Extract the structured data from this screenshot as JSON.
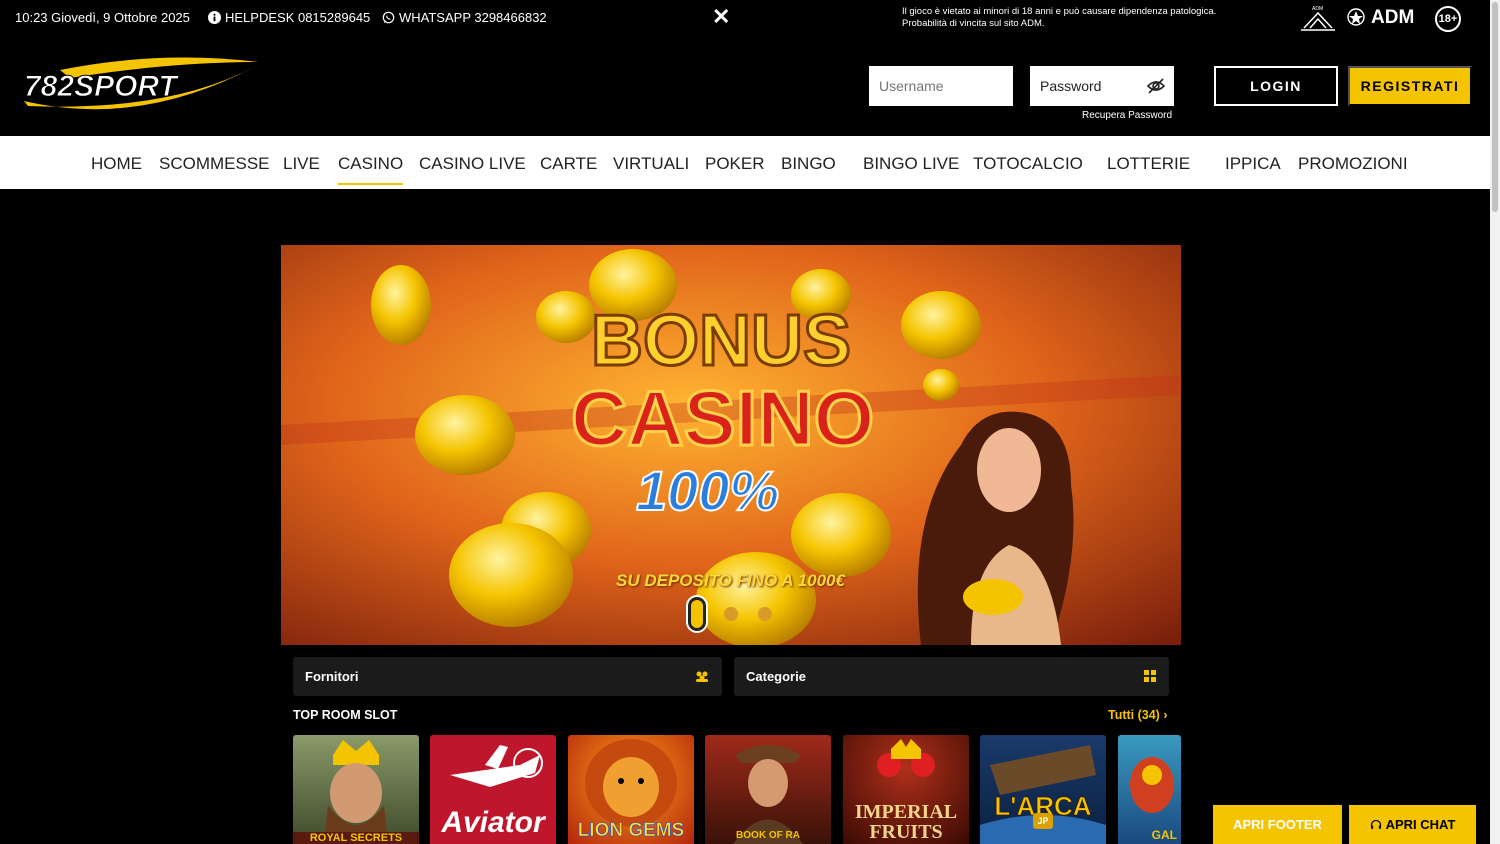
{
  "topbar": {
    "datetime": "10:23 Giovedì, 9 Ottobre 2025",
    "helpdesk": "HELPDESK 0815289645",
    "whatsapp": "WHATSAPP 3298466832",
    "close": "✕",
    "warning": "Il gioco è vietato ai minori di 18 anni e può causare dipendenza patologica. Probabilità di vincita sul sito ADM.",
    "adm_small": "ADM",
    "adm": "ADM",
    "age": "18+"
  },
  "header": {
    "logo_text": "782SPORT",
    "username_placeholder": "Username",
    "password_placeholder": "Password",
    "recupera": "Recupera Password",
    "login": "LOGIN",
    "registrati": "REGISTRATI"
  },
  "nav": [
    {
      "label": "HOME",
      "active": false
    },
    {
      "label": "SCOMMESSE",
      "active": false
    },
    {
      "label": "LIVE",
      "active": false
    },
    {
      "label": "CASINO",
      "active": true
    },
    {
      "label": "CASINO LIVE",
      "active": false
    },
    {
      "label": "CARTE",
      "active": false
    },
    {
      "label": "VIRTUALI",
      "active": false
    },
    {
      "label": "POKER",
      "active": false
    },
    {
      "label": "BINGO",
      "active": false
    },
    {
      "label": "BINGO LIVE",
      "active": false
    },
    {
      "label": "TOTOCALCIO",
      "active": false
    },
    {
      "label": "LOTTERIE",
      "active": false
    },
    {
      "label": "IPPICA",
      "active": false
    },
    {
      "label": "PROMOZIONI",
      "active": false
    }
  ],
  "banner": {
    "line1": "BONUS",
    "line2": "CASINO",
    "line3": "100%",
    "subtitle": "SU DEPOSITO FINO A 1000€",
    "slides": 3,
    "active_slide": 1
  },
  "filters": {
    "fornitori": "Fornitori",
    "categorie": "Categorie"
  },
  "section": {
    "title": "TOP ROOM SLOT",
    "all_link": "Tutti (34)"
  },
  "games": [
    {
      "title": "ROYAL SECRETS"
    },
    {
      "title": "Aviator"
    },
    {
      "title": "LION GEMS"
    },
    {
      "title": "BOOK OF RA"
    },
    {
      "title_line1": "IMPERIAL",
      "title_line2": "FRUITS"
    },
    {
      "title": "L'ARCA",
      "badge": "JP"
    },
    {
      "title": "GAL"
    }
  ],
  "footer_buttons": {
    "footer": "APRI FOOTER",
    "chat": "APRI CHAT"
  },
  "colors": {
    "accent": "#f5c400",
    "background": "#000000",
    "nav_bg": "#ffffff"
  }
}
